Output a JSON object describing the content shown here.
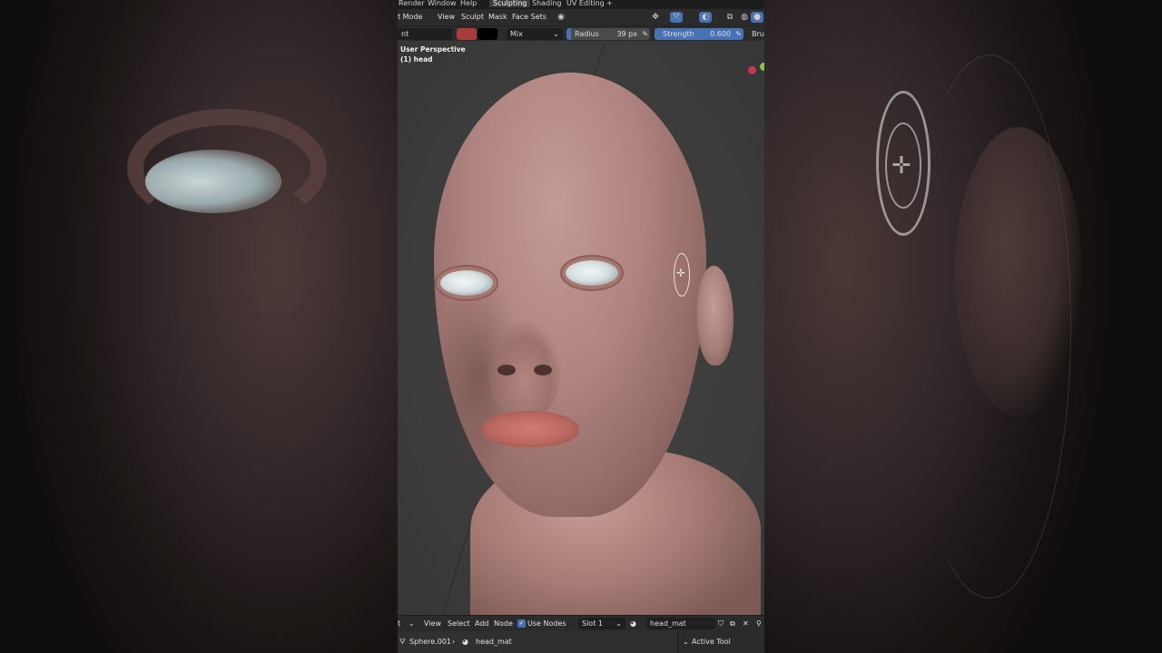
{
  "top_menu": {
    "render": "Render",
    "window": "Window",
    "help": "Help",
    "tab_sculpting": "Sculpting",
    "tab_shading": "Shading",
    "tab_uv_editing": "UV Editing",
    "add_tab": "+"
  },
  "header": {
    "mode": "t Mode",
    "view": "View",
    "sculpt": "Sculpt",
    "mask": "Mask",
    "face_sets": "Face Sets"
  },
  "tool_settings": {
    "brush_name": "nt",
    "color_primary": "#a83b3b",
    "color_secondary": "#000000",
    "blend_mode": "Mix",
    "radius_label": "Radius",
    "radius_value": "39 px",
    "strength_label": "Strength",
    "strength_value": "0.600",
    "brush_cut": "Brus"
  },
  "viewport": {
    "perspective": "User Perspective",
    "object": "(1) head"
  },
  "shader_header": {
    "editor": "t",
    "view": "View",
    "select": "Select",
    "add": "Add",
    "node": "Node",
    "use_nodes": "Use Nodes",
    "slot": "Slot 1",
    "material": "head_mat"
  },
  "breadcrumb": {
    "object": "Sphere.001",
    "material": "head_mat"
  },
  "side_panel": {
    "active_tool": "Active Tool"
  }
}
